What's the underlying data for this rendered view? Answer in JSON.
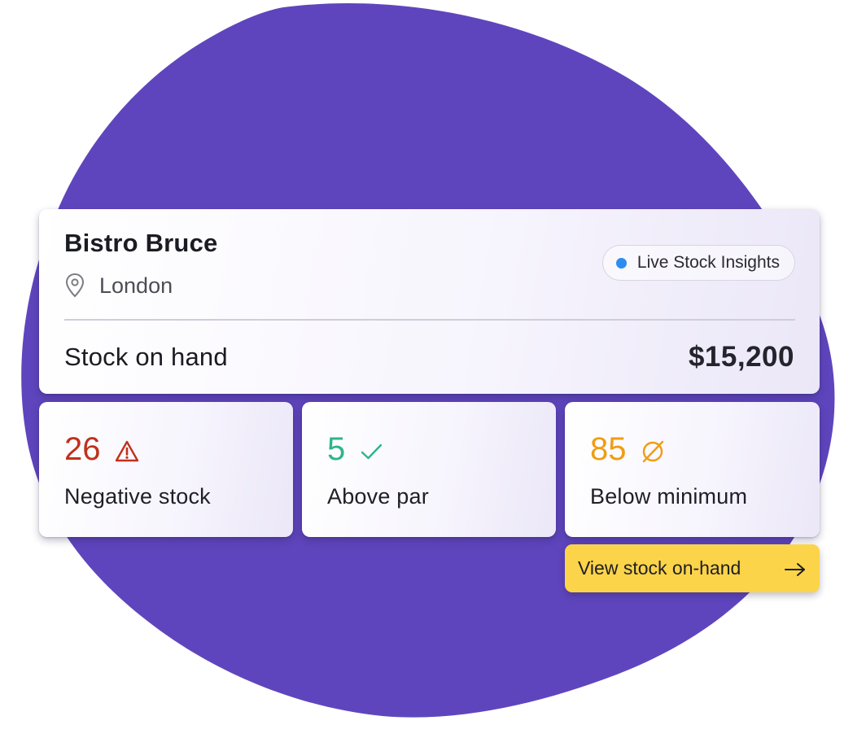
{
  "venue": {
    "name": "Bistro Bruce",
    "location": "London",
    "location_icon": "map-pin-icon"
  },
  "badge": {
    "label": "Live Stock Insights",
    "dot_color": "#2a8ef0"
  },
  "summary": {
    "label": "Stock on hand",
    "value": "$15,200"
  },
  "stats": [
    {
      "value": "26",
      "label": "Negative stock",
      "icon": "warning-triangle-icon",
      "color": "#c0311d"
    },
    {
      "value": "5",
      "label": "Above par",
      "icon": "checkmark-icon",
      "color": "#2fb58a"
    },
    {
      "value": "85",
      "label": "Below minimum",
      "icon": "empty-set-icon",
      "color": "#ef9d14"
    }
  ],
  "cta": {
    "label": "View stock on-hand",
    "icon": "arrow-right-icon",
    "color": "#fbd449"
  },
  "colors": {
    "blob": "#5f45bd"
  }
}
